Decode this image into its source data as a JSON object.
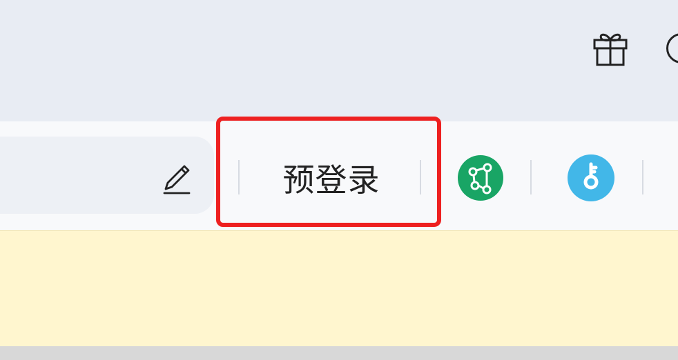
{
  "toolbar": {
    "prelogin_label": "预登录",
    "icons": {
      "gift": "gift-icon",
      "partial_circle": "circle-icon",
      "pencil": "pencil-icon",
      "share": "share-icon",
      "key": "key-icon"
    }
  },
  "colors": {
    "highlight": "#ee2020",
    "share_green": "#19a565",
    "key_blue": "#42b7e8",
    "banner": "#fff6cf"
  }
}
